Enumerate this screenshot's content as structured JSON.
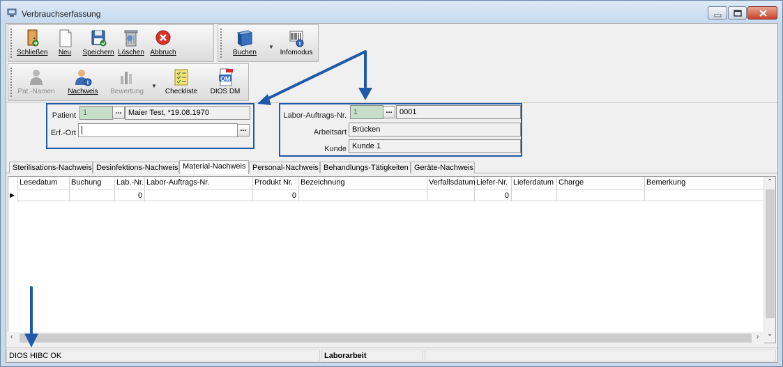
{
  "window": {
    "title": "Verbrauchserfassung"
  },
  "toolbar1": {
    "close_label": "Schließen",
    "new_label": "Neu",
    "save_label": "Speichern",
    "delete_label": "Löschen",
    "cancel_label": "Abbruch"
  },
  "toolbar2": {
    "book_label": "Buchen",
    "info_label": "Infomodus"
  },
  "toolbar3": {
    "patnames_label": "Pat.-Namen",
    "nachweis_label": "Nachweis",
    "bewertung_label": "Bewertung",
    "checklist_label": "Checkliste",
    "diosdm_label": "DIOS DM",
    "diosdm_badge": "QM"
  },
  "form": {
    "patient_label": "Patient",
    "patient_id": "1",
    "patient_name": "Maier Test, *19.08.1970",
    "erfort_label": "Erf.-Ort",
    "erfort_value": "",
    "labor_label": "Labor-Auftrags-Nr.",
    "labor_id": "1",
    "labor_number": "0001",
    "arbeitsart_label": "Arbeitsart",
    "arbeitsart_value": "Brücken",
    "kunde_label": "Kunde",
    "kunde_value": "Kunde 1",
    "ellipsis": "..."
  },
  "tabs": [
    {
      "label": "Sterilisations-Nachweis"
    },
    {
      "label": "Desinfektions-Nachweis"
    },
    {
      "label": "Material-Nachweis"
    },
    {
      "label": "Personal-Nachweis"
    },
    {
      "label": "Behandlungs-Tätigkeiten"
    },
    {
      "label": "Geräte-Nachweis"
    }
  ],
  "active_tab": "Material-Nachweis",
  "grid": {
    "columns": [
      "Lesedatum",
      "Buchung",
      "Lab.-Nr.",
      "Labor-Auftrags-Nr.",
      "Produkt Nr.",
      "Bezeichnung",
      "Verfallsdatum",
      "Liefer-Nr.",
      "Lieferdatum",
      "Charge",
      "Bemerkung"
    ],
    "row": [
      "",
      "",
      "0",
      "",
      "0",
      "",
      "",
      "0",
      "",
      "",
      ""
    ]
  },
  "status": {
    "left": "DIOS HIBC OK",
    "middle": "Laborarbeit"
  },
  "colors": {
    "highlight_box": "#1e5aa8",
    "field_green": "#c7dfc8",
    "window_frame": "#c9daee"
  }
}
